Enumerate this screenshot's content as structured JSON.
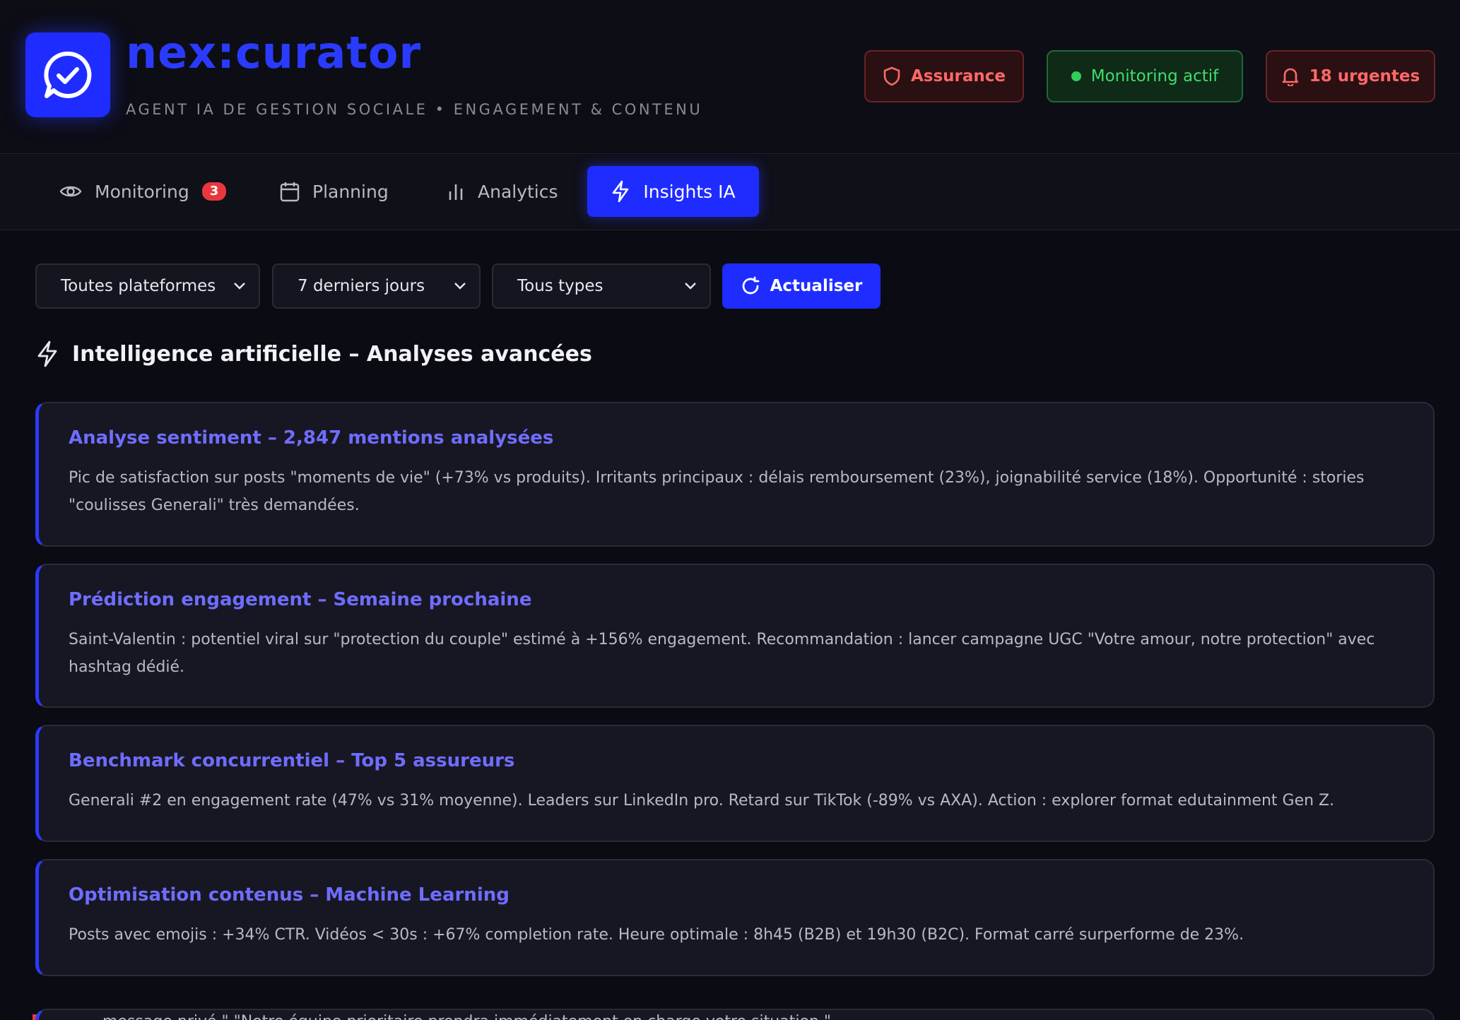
{
  "header": {
    "brand": "nex:curator",
    "tagline": "AGENT IA DE GESTION SOCIALE • ENGAGEMENT & CONTENU",
    "buttons": {
      "assurance": "Assurance",
      "monitoring": "Monitoring actif",
      "urgent": "18 urgentes"
    }
  },
  "tabs": [
    {
      "label": "Monitoring",
      "badge": "3"
    },
    {
      "label": "Planning"
    },
    {
      "label": "Analytics"
    },
    {
      "label": "Insights IA",
      "active": true
    }
  ],
  "filters": {
    "platform": "Toutes plateformes",
    "period": "7 derniers jours",
    "type": "Tous types",
    "refresh": "Actualiser"
  },
  "section": {
    "title": "Intelligence artificielle – Analyses avancées"
  },
  "insights": [
    {
      "title": "Analyse sentiment – 2,847 mentions analysées",
      "text": "Pic de satisfaction sur posts \"moments de vie\" (+73% vs produits). Irritants principaux : délais remboursement (23%), joignabilité service (18%). Opportunité : stories \"coulisses Generali\" très demandées."
    },
    {
      "title": "Prédiction engagement – Semaine prochaine",
      "text": "Saint-Valentin : potentiel viral sur \"protection du couple\" estimé à +156% engagement. Recommandation : lancer campagne UGC \"Votre amour, notre protection\" avec hashtag dédié."
    },
    {
      "title": "Benchmark concurrentiel – Top 5 assureurs",
      "text": "Generali #2 en engagement rate (47% vs 31% moyenne). Leaders sur LinkedIn pro. Retard sur TikTok (-89% vs AXA). Action : explorer format edutainment Gen Z."
    },
    {
      "title": "Optimisation contenus – Machine Learning",
      "text": "Posts avec emojis : +34% CTR. Vidéos < 30s : +67% completion rate. Heure optimale : 8h45 (B2B) et 19h30 (B2C). Format carré surperforme de 23%."
    }
  ],
  "peek_text": "message privé.\" \"Notre équipe prioritaire prendra immédiatement en charge votre situation.\"",
  "colors": {
    "accent": "#1f2cff",
    "card_title": "#6f6dff",
    "danger": "#ff6868",
    "success": "#3fdc6e"
  }
}
